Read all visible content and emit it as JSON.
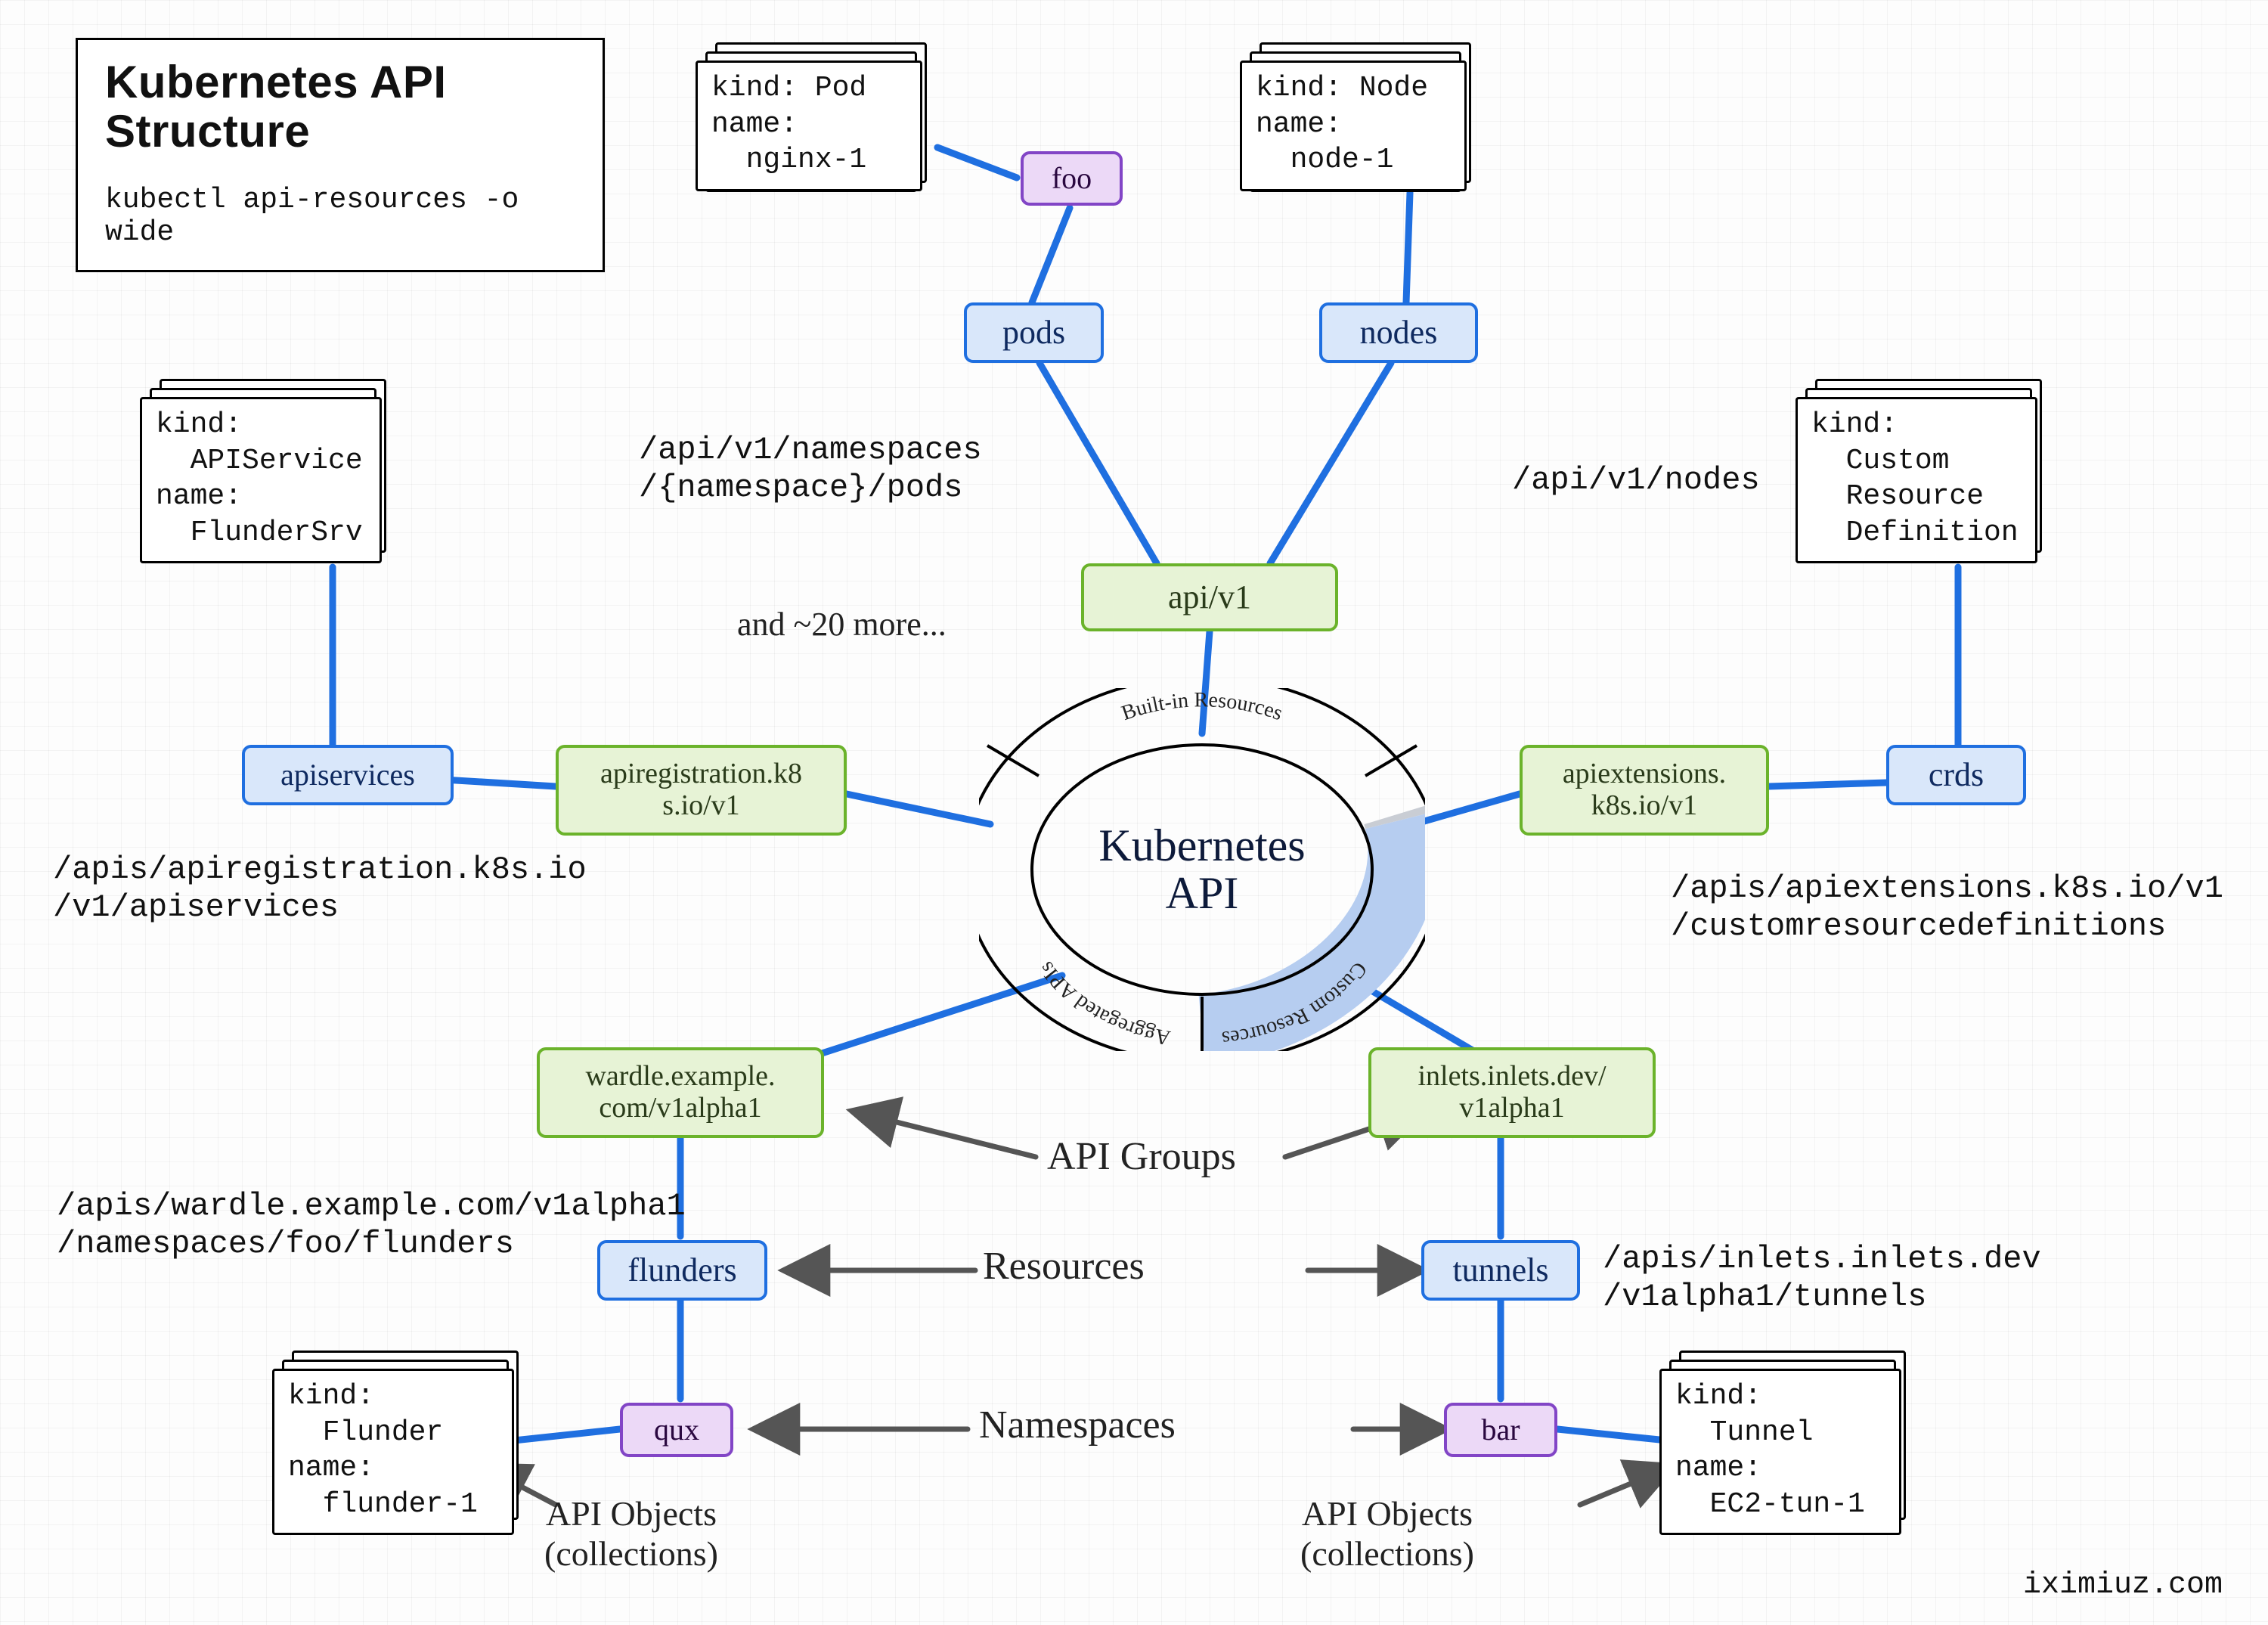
{
  "title": {
    "heading_line1": "Kubernetes API",
    "heading_line2": "Structure",
    "command": "kubectl api-resources -o wide"
  },
  "ring": {
    "center_line1": "Kubernetes",
    "center_line2": "API",
    "segments": {
      "builtin": "Built-in Resources",
      "custom": "Custom Resources",
      "aggregated": "Aggregated APIs"
    }
  },
  "hand_labels": {
    "and_more": "and ~20 more...",
    "api_groups": "API Groups",
    "resources": "Resources",
    "namespaces": "Namespaces",
    "api_objects_left": "API Objects\n(collections)",
    "api_objects_right": "API Objects\n(collections)"
  },
  "groups": {
    "api_v1": "api/v1",
    "apiregistration": "apiregistration.k8\ns.io/v1",
    "apiextensions": "apiextensions.\nk8s.io/v1",
    "wardle": "wardle.example.\ncom/v1alpha1",
    "inlets": "inlets.inlets.dev/\nv1alpha1"
  },
  "resources": {
    "pods": "pods",
    "nodes": "nodes",
    "apiservices": "apiservices",
    "crds": "crds",
    "flunders": "flunders",
    "tunnels": "tunnels"
  },
  "namespaces": {
    "foo": "foo",
    "qux": "qux",
    "bar": "bar"
  },
  "paths": {
    "pods": "/api/v1/namespaces\n/{namespace}/pods",
    "nodes": "/api/v1/nodes",
    "apiservices": "/apis/apiregistration.k8s.io\n/v1/apiservices",
    "crds": "/apis/apiextensions.k8s.io/v1\n/customresourcedefinitions",
    "wardle": "/apis/wardle.example.com/v1alpha1\n/namespaces/foo/flunders",
    "inlets": "/apis/inlets.inlets.dev\n/v1alpha1/tunnels"
  },
  "objects": {
    "pod": "kind: Pod\nname:\n  nginx-1",
    "node": "kind: Node\nname:\n  node-1",
    "apiservice": "kind:\n  APIService\nname:\n  FlunderSrv",
    "crd": "kind:\n  Custom\n  Resource\n  Definition",
    "flunder": "kind:\n  Flunder\nname:\n  flunder-1",
    "tunnel": "kind:\n  Tunnel\nname:\n  EC2-tun-1"
  },
  "credit": "iximiuz.com"
}
